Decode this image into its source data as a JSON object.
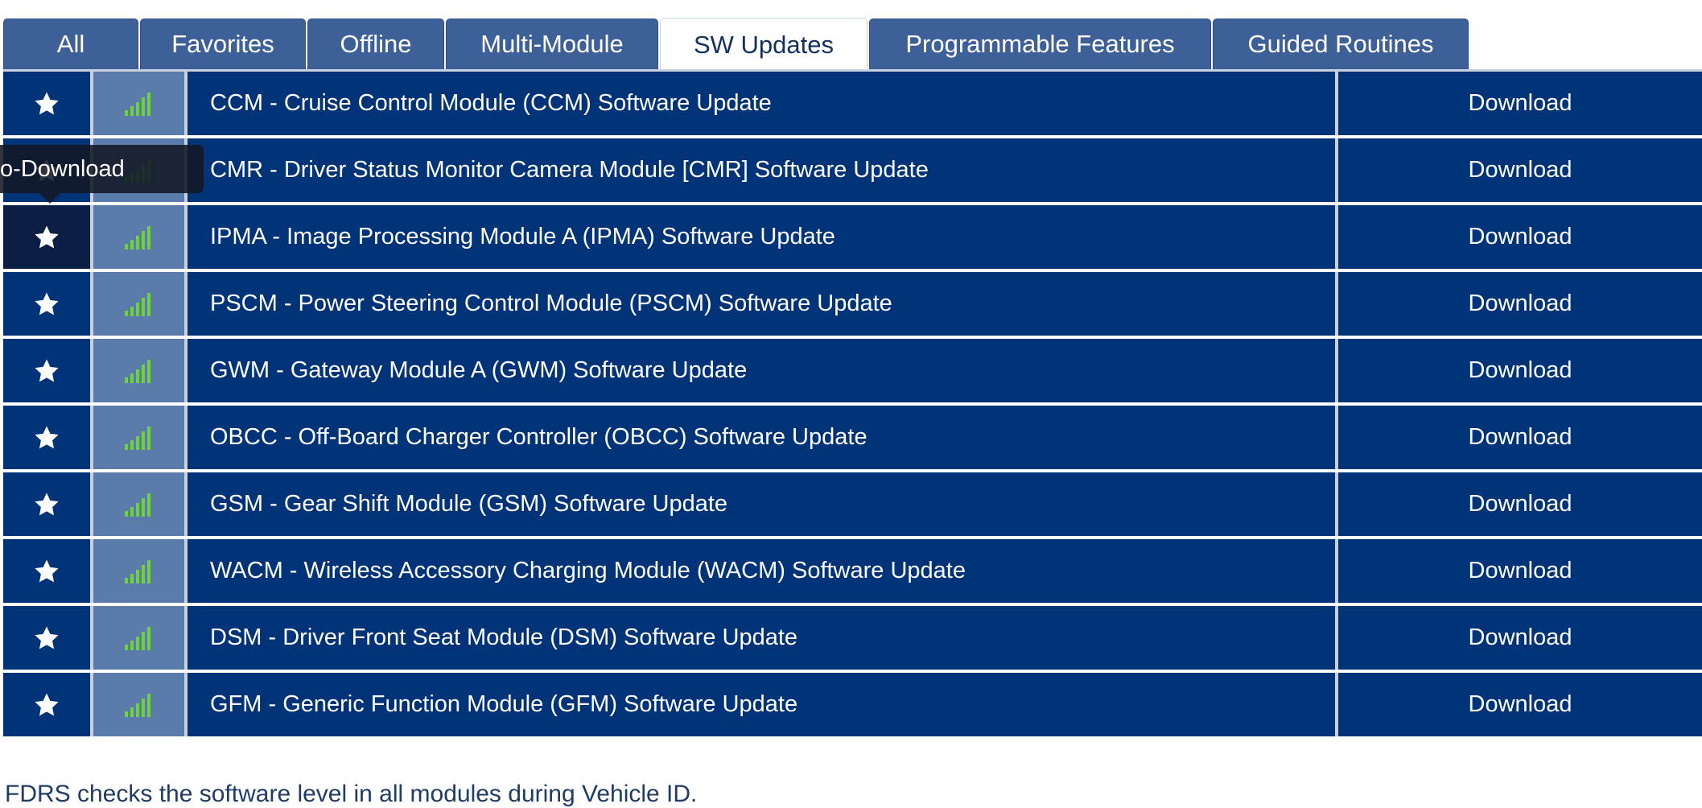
{
  "tabs": [
    {
      "label": "All",
      "width": 168
    },
    {
      "label": "Favorites",
      "width": 206
    },
    {
      "label": "Offline",
      "width": 170
    },
    {
      "label": "Multi-Module",
      "width": 264
    },
    {
      "label": "SW Updates",
      "width": 258,
      "active": true
    },
    {
      "label": "Programmable Features",
      "width": 425
    },
    {
      "label": "Guided Routines",
      "width": 318
    }
  ],
  "rows": [
    {
      "name": "CCM - Cruise Control Module (CCM) Software Update",
      "action": "Download"
    },
    {
      "name": "CMR - Driver Status Monitor Camera Module [CMR] Software Update",
      "action": "Download"
    },
    {
      "name": "IPMA - Image Processing Module A (IPMA) Software Update",
      "action": "Download"
    },
    {
      "name": "PSCM - Power Steering Control Module (PSCM) Software Update",
      "action": "Download"
    },
    {
      "name": "GWM - Gateway Module A (GWM) Software Update",
      "action": "Download"
    },
    {
      "name": "OBCC - Off-Board Charger Controller (OBCC) Software Update",
      "action": "Download"
    },
    {
      "name": "GSM - Gear Shift Module (GSM) Software Update",
      "action": "Download"
    },
    {
      "name": "WACM - Wireless Accessory Charging Module (WACM) Software Update",
      "action": "Download"
    },
    {
      "name": "DSM - Driver Front Seat Module (DSM) Software Update",
      "action": "Download"
    },
    {
      "name": "GFM - Generic Function Module (GFM) Software Update",
      "action": "Download"
    }
  ],
  "tooltip": {
    "text": "to-Download"
  },
  "footer": {
    "text": "FDRS checks the software level in all modules during Vehicle ID."
  },
  "colors": {
    "row_bg": "#003378",
    "signal_bg": "#5b7bab",
    "signal_bars": "#6ed23c",
    "tab_bg": "#3e6098"
  },
  "icons": {
    "favorite": "star-icon",
    "connection": "signal-strength-icon"
  }
}
